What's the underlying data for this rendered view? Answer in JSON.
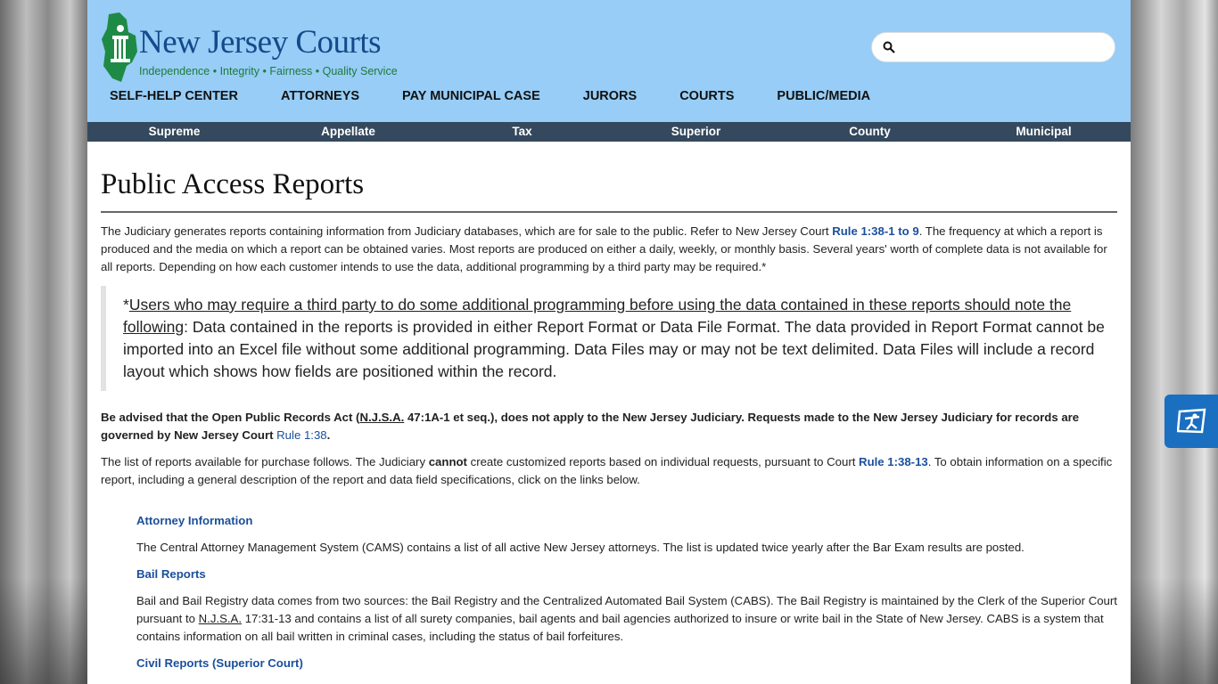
{
  "header": {
    "logo_title": "New Jersey Courts",
    "logo_tagline": "Independence • Integrity • Fairness • Quality Service",
    "search_placeholder": "",
    "nav": [
      "SELF-HELP CENTER",
      "ATTORNEYS",
      "PAY MUNICIPAL CASE",
      "JURORS",
      "COURTS",
      "PUBLIC/MEDIA"
    ],
    "subnav": [
      "Supreme",
      "Appellate",
      "Tax",
      "Superior",
      "County",
      "Municipal"
    ]
  },
  "main": {
    "title": "Public Access Reports",
    "intro_a": "The Judiciary generates reports containing information from Judiciary databases, which are for sale to the public. Refer to New Jersey Court ",
    "intro_link": "Rule 1:38-1 to 9",
    "intro_b": ". The frequency at which a report is produced and the media on which a report can be obtained varies. Most reports are produced on either a daily, weekly, or monthly basis. Several years' worth of complete data is not available for all reports. Depending on how each customer intends to use the data, additional programming by a third party may be required.*",
    "quote_star": "*",
    "quote_underlined": "Users who may require a third party to do some additional programming before using the data contained in these reports should note the following",
    "quote_rest": ": Data contained in the reports is provided in either Report Format or Data File Format. The data provided in Report Format cannot be imported into an Excel file without some additional programming. Data Files may or may not be text delimited. Data Files will include a record layout which shows how fields are positioned within the record.",
    "advised_a": "Be advised that the Open Public Records Act (",
    "advised_abbr": "N.J.S.A.",
    "advised_b": " 47:1A-1 et seq.), does not apply to the New Jersey Judiciary. Requests made to the New Jersey Judiciary for records are governed by New Jersey Court ",
    "advised_link": "Rule 1:38",
    "advised_c": ".",
    "list_a": "The list of reports available for purchase follows. The Judiciary ",
    "list_bold": "cannot",
    "list_b": " create customized reports based on individual requests, pursuant to Court ",
    "list_link": "Rule 1:38-13",
    "list_c": ". To obtain information on a specific report, including a general description of the report and data field specifications, click on the links below.",
    "reports": [
      {
        "title": "Attorney Information",
        "desc": "The Central Attorney Management System (CAMS) contains a list of all active New Jersey attorneys. The list is updated twice yearly after the Bar Exam results are posted."
      },
      {
        "title": "Bail Reports",
        "desc_a": "Bail and Bail Registry data comes from two sources: the Bail Registry and the Centralized Automated Bail System (CABS). The Bail Registry is maintained by the Clerk of the Superior Court pursuant to ",
        "desc_abbr": "N.J.S.A.",
        "desc_b": " 17:31-13 and contains a list of all surety companies, bail agents and bail agencies authorized to insure or write bail in the State of New Jersey. CABS is a system that contains information on all bail written in criminal cases, including the status of bail forfeitures."
      },
      {
        "title": "Civil Reports (Superior Court)"
      }
    ]
  },
  "colors": {
    "header_bg": "#97cdf6",
    "subnav_bg": "#34495e",
    "link": "#1a4f9c",
    "accessibility_button": "#1a6fc0"
  }
}
